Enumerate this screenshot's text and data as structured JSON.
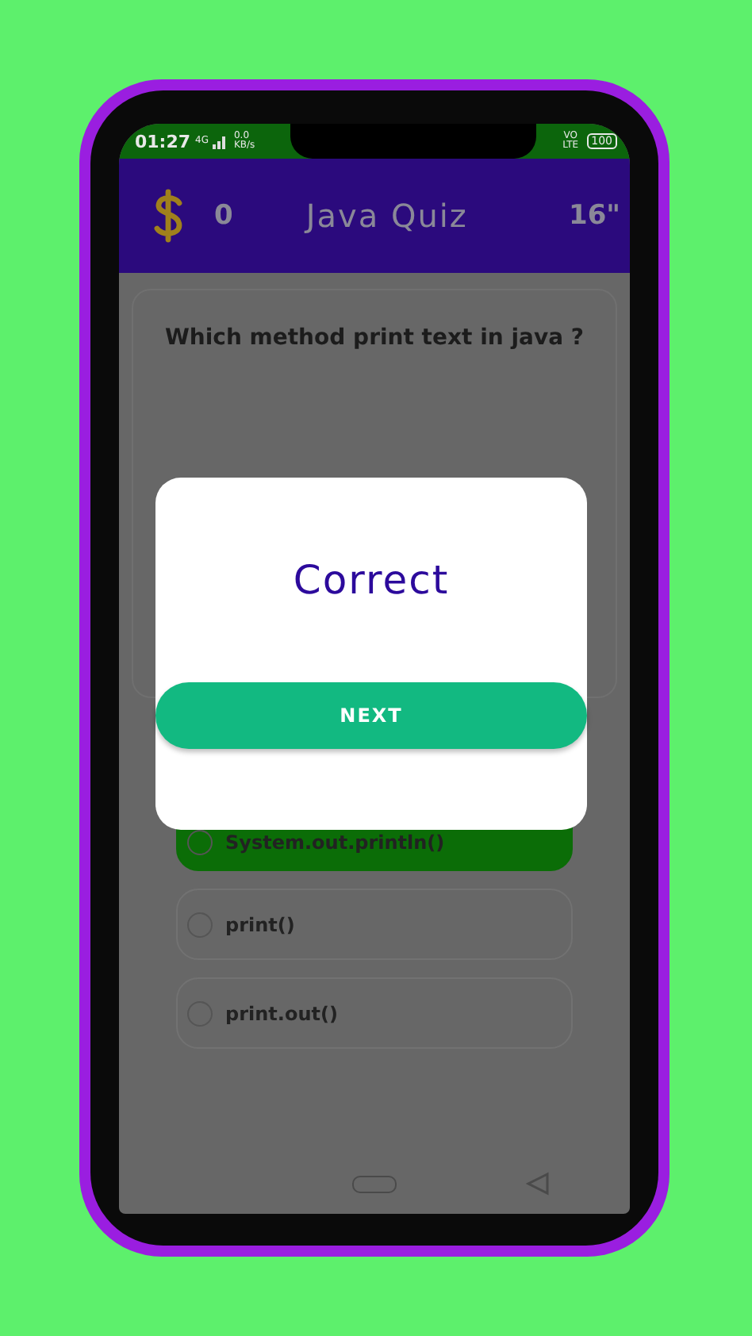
{
  "status_bar": {
    "time": "01:27",
    "network_type": "4G",
    "speed": "0.0 KB/s",
    "carrier": "VO LTE",
    "battery": "100"
  },
  "app_bar": {
    "score": "0",
    "title": "Java Quiz",
    "timer": "16\""
  },
  "question": "Which method print text in java ?",
  "options": [
    {
      "label": "System.out.println()",
      "selected": true
    },
    {
      "label": "print()",
      "selected": false
    },
    {
      "label": "print.out()",
      "selected": false
    }
  ],
  "dialog": {
    "message": "Correct",
    "button": "NEXT"
  }
}
